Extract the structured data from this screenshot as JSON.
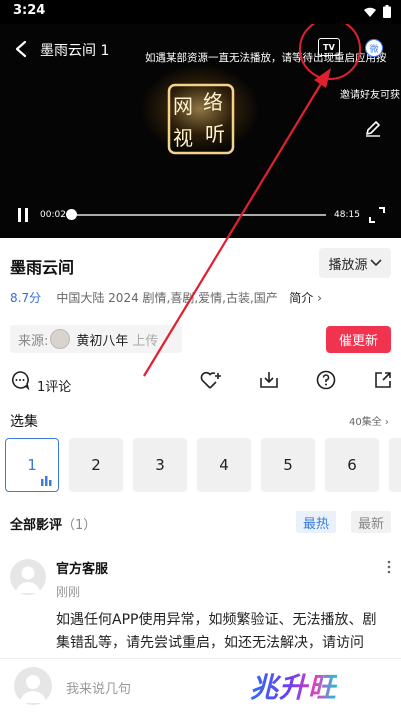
{
  "status_bar": {
    "time": "3:24"
  },
  "player": {
    "title": "墨雨云间 1",
    "marquee": "如遇某部资源一直无法播放，请等待出现重启应用按",
    "tv_label": "TV",
    "share_label": "微",
    "invite": "邀请好友可获",
    "current_time": "00:02",
    "duration": "48:15",
    "progress": 0.005,
    "logo_text": [
      "网",
      "络",
      "视",
      "听"
    ]
  },
  "show": {
    "title": "墨雨云间",
    "source_button": "播放源",
    "score": "8.7分",
    "meta": "中国大陆  2024  剧情,喜剧,爱情,古装,国产",
    "intro": "简介",
    "uploader_label": "来源:",
    "uploader_name": "黄初八年",
    "uploader_suffix": "上传",
    "urge_button": "催更新"
  },
  "actions": {
    "comment_count": "1评论"
  },
  "episodes": {
    "label": "选集",
    "total": "40集全",
    "items": [
      "1",
      "2",
      "3",
      "4",
      "5",
      "6"
    ],
    "active_index": 0
  },
  "reviews": {
    "label": "全部影评",
    "count": "（1）",
    "sort_hot": "最热",
    "sort_new": "最新",
    "comment": {
      "author": "官方客服",
      "time": "刚刚",
      "body": "如遇任何APP使用异常，如频繁验证、无法播放、剧集错乱等，请先尝试重启，如还无法解决，请访问"
    }
  },
  "bottom_bar": {
    "placeholder": "我来说几句"
  },
  "watermark": "兆升旺",
  "colors": {
    "accent": "#3b7ed8",
    "urge": "#f0344f",
    "annotation": "#e02030"
  }
}
